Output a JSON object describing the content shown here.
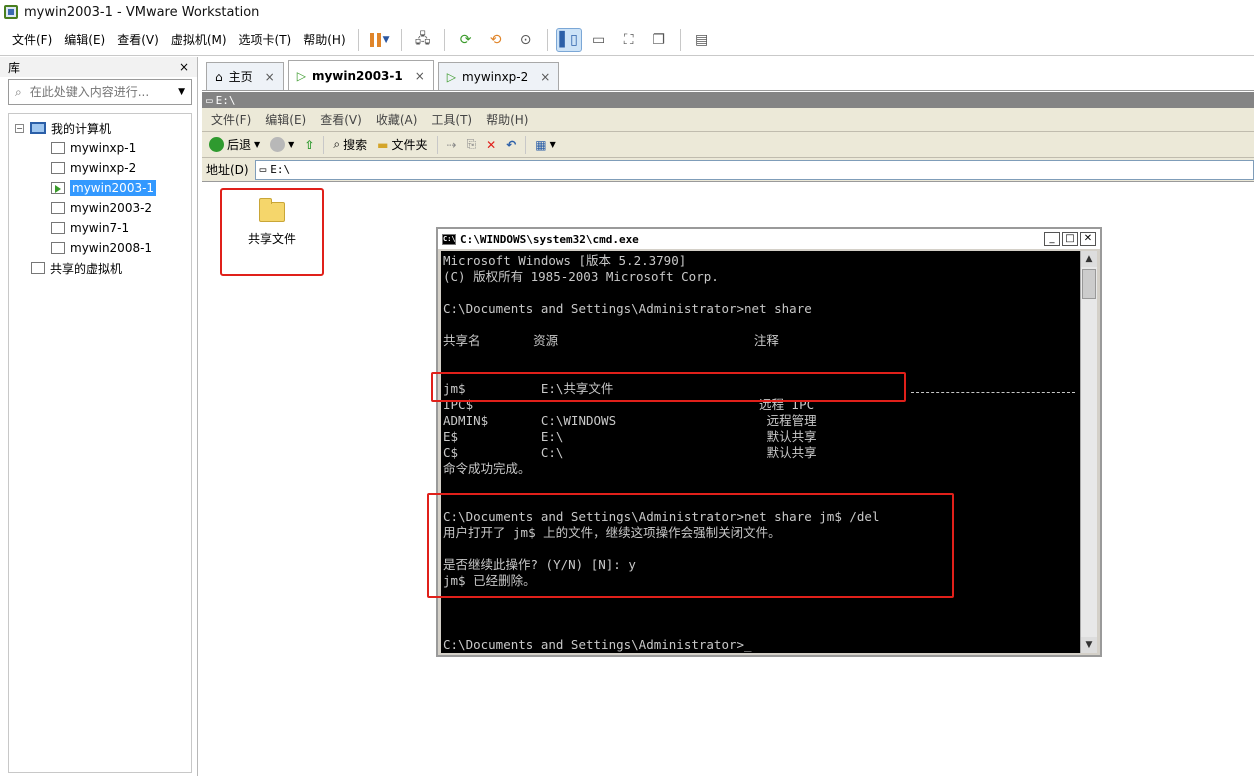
{
  "window": {
    "title": "mywin2003-1 - VMware Workstation"
  },
  "menu": [
    {
      "label": "文件(F)"
    },
    {
      "label": "编辑(E)"
    },
    {
      "label": "查看(V)"
    },
    {
      "label": "虚拟机(M)"
    },
    {
      "label": "选项卡(T)"
    },
    {
      "label": "帮助(H)"
    }
  ],
  "library": {
    "title": "库",
    "close": "×",
    "search_placeholder": "在此处键入内容进行...",
    "tree": {
      "root": "我的计算机",
      "items": [
        {
          "label": "mywinxp-1"
        },
        {
          "label": "mywinxp-2"
        },
        {
          "label": "mywin2003-1"
        },
        {
          "label": "mywin2003-2"
        },
        {
          "label": "mywin7-1"
        },
        {
          "label": "mywin2008-1"
        }
      ],
      "shared": "共享的虚拟机"
    }
  },
  "tabs": [
    {
      "label": "主页"
    },
    {
      "label": "mywin2003-1"
    },
    {
      "label": "mywinxp-2"
    }
  ],
  "guest": {
    "pathbar": "E:\\",
    "explorer_menu": [
      "文件(F)",
      "编辑(E)",
      "查看(V)",
      "收藏(A)",
      "工具(T)",
      "帮助(H)"
    ],
    "toolbar": {
      "back": "后退",
      "search": "搜索",
      "folders": "文件夹"
    },
    "address_label": "地址(D)",
    "address_value": "E:\\",
    "folder_label": "共享文件"
  },
  "cmd": {
    "title": "C:\\WINDOWS\\system32\\cmd.exe",
    "lines": [
      "Microsoft Windows [版本 5.2.3790]",
      "(C) 版权所有 1985-2003 Microsoft Corp.",
      "",
      "C:\\Documents and Settings\\Administrator>net share",
      "",
      "共享名       资源                          注释",
      "",
      "",
      "jm$          E:\\共享文件",
      "IPC$                                      远程 IPC",
      "ADMIN$       C:\\WINDOWS                    远程管理",
      "E$           E:\\                           默认共享",
      "C$           C:\\                           默认共享",
      "命令成功完成。",
      "",
      "",
      "C:\\Documents and Settings\\Administrator>net share jm$ /del",
      "用户打开了 jm$ 上的文件，继续这项操作会强制关闭文件。",
      "",
      "是否继续此操作? (Y/N) [N]: y",
      "jm$ 已经删除。",
      "",
      "",
      "",
      "C:\\Documents and Settings\\Administrator>_"
    ]
  },
  "colors": {
    "highlight": "#e0201a",
    "selection": "#3399ff",
    "console_bg": "#000000",
    "console_fg": "#c8c8c8"
  }
}
